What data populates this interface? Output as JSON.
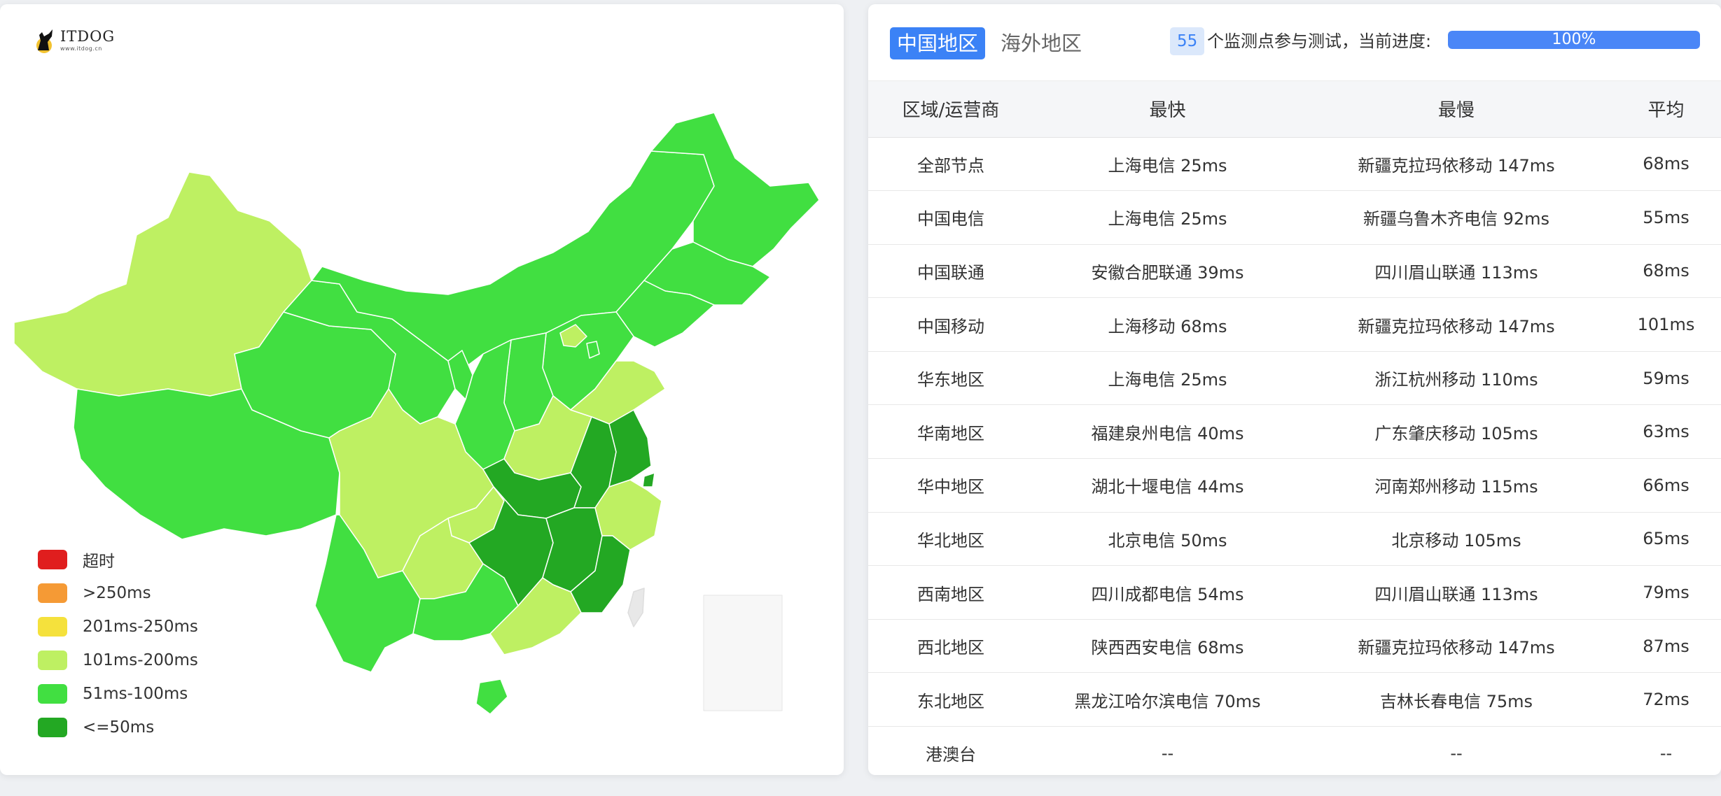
{
  "logo": {
    "name": "ITDOG",
    "url": "www.itdog.cn"
  },
  "legend": [
    {
      "label": "超时",
      "color": "#e01e1e"
    },
    {
      "label": ">250ms",
      "color": "#f59a35"
    },
    {
      "label": "201ms-250ms",
      "color": "#f5e13c"
    },
    {
      "label": "101ms-200ms",
      "color": "#bef062"
    },
    {
      "label": "51ms-100ms",
      "color": "#41df41"
    },
    {
      "label": "<=50ms",
      "color": "#23a823"
    }
  ],
  "tabs": {
    "china": "中国地区",
    "overseas": "海外地区"
  },
  "status": {
    "count": "55",
    "text": "个监测点参与测试，当前进度:",
    "progress_label": "100%",
    "progress": 100
  },
  "table": {
    "headers": [
      "区域/运营商",
      "最快",
      "最慢",
      "平均"
    ],
    "rows": [
      [
        "全部节点",
        "上海电信 25ms",
        "新疆克拉玛依移动 147ms",
        "68ms"
      ],
      [
        "中国电信",
        "上海电信 25ms",
        "新疆乌鲁木齐电信 92ms",
        "55ms"
      ],
      [
        "中国联通",
        "安徽合肥联通 39ms",
        "四川眉山联通 113ms",
        "68ms"
      ],
      [
        "中国移动",
        "上海移动 68ms",
        "新疆克拉玛依移动 147ms",
        "101ms"
      ],
      [
        "华东地区",
        "上海电信 25ms",
        "浙江杭州移动 110ms",
        "59ms"
      ],
      [
        "华南地区",
        "福建泉州电信 40ms",
        "广东肇庆移动 105ms",
        "63ms"
      ],
      [
        "华中地区",
        "湖北十堰电信 44ms",
        "河南郑州移动 115ms",
        "66ms"
      ],
      [
        "华北地区",
        "北京电信 50ms",
        "北京移动 105ms",
        "65ms"
      ],
      [
        "西南地区",
        "四川成都电信 54ms",
        "四川眉山联通 113ms",
        "79ms"
      ],
      [
        "西北地区",
        "陕西西安电信 68ms",
        "新疆克拉玛依移动 147ms",
        "87ms"
      ],
      [
        "东北地区",
        "黑龙江哈尔滨电信 70ms",
        "吉林长春电信 75ms",
        "72ms"
      ],
      [
        "港澳台",
        "--",
        "--",
        "--"
      ]
    ]
  }
}
